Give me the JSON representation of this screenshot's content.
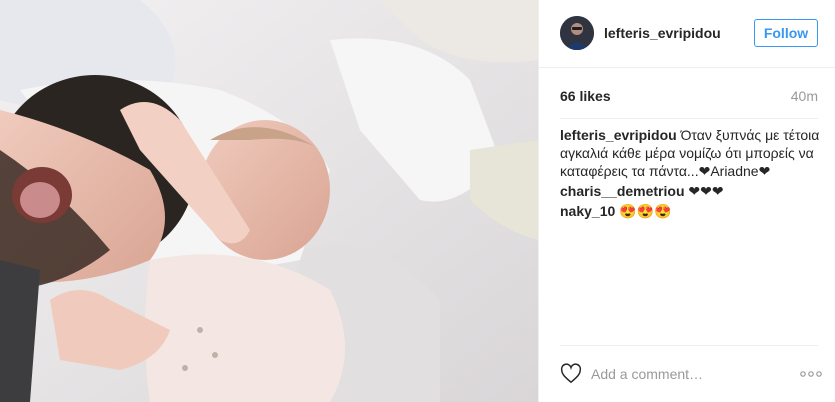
{
  "post": {
    "username": "lefteris_evripidou",
    "follow_label": "Follow",
    "likes": "66 likes",
    "time": "40m"
  },
  "comments": [
    {
      "user": "lefteris_evripidou",
      "text": "Όταν ξυπνάς με τέτοια αγκαλιά κάθε μέρα νομίζω ότι μπορείς να καταφέρεις τα πάντα...❤Ariadne❤"
    },
    {
      "user": "charis__demetriou",
      "text": "❤❤❤"
    },
    {
      "user": "naky_10",
      "text": "😍😍😍"
    }
  ],
  "add_comment": {
    "placeholder": "Add a comment…"
  },
  "icons": {
    "like": "heart-icon",
    "more": "more-options-icon"
  },
  "colors": {
    "accent": "#3897f0",
    "muted": "#999999",
    "text": "#262626"
  }
}
